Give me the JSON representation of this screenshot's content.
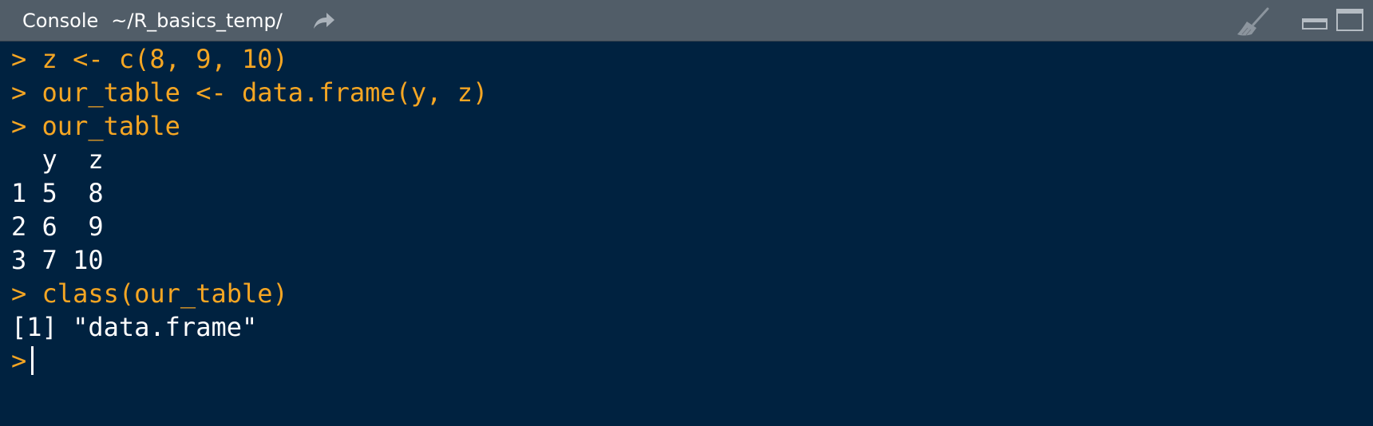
{
  "header": {
    "title": "Console",
    "path": "~/R_basics_temp/",
    "icons": {
      "navigate": "arrow-forward-icon",
      "clear": "broom-icon",
      "minimize": "minimize-pane-icon",
      "maximize": "maximize-pane-icon"
    }
  },
  "console": {
    "prompt_symbol": ">",
    "lines": [
      {
        "kind": "command",
        "prompt": ">",
        "text": "z <- c(8, 9, 10)"
      },
      {
        "kind": "command",
        "prompt": ">",
        "text": "our_table <- data.frame(y, z)"
      },
      {
        "kind": "command",
        "prompt": ">",
        "text": "our_table"
      },
      {
        "kind": "output",
        "text": "  y  z"
      },
      {
        "kind": "output",
        "text": "1 5  8"
      },
      {
        "kind": "output",
        "text": "2 6  9"
      },
      {
        "kind": "output",
        "text": "3 7 10"
      },
      {
        "kind": "command",
        "prompt": ">",
        "text": "class(our_table)"
      },
      {
        "kind": "output",
        "text": "[1] \"data.frame\""
      }
    ],
    "current_input": ""
  },
  "colors": {
    "background": "#002240",
    "titlebar": "#515d68",
    "command": "#f5a623",
    "output": "#ffffff"
  }
}
